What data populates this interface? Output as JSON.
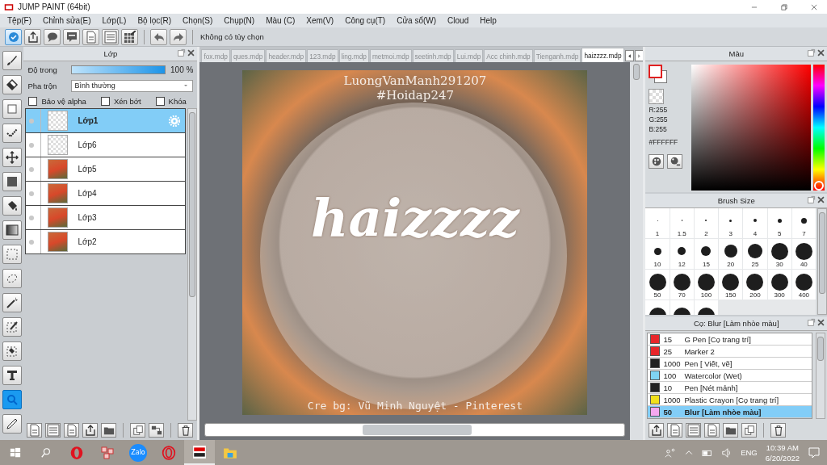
{
  "window": {
    "title": "JUMP PAINT (64bit)"
  },
  "menu": [
    "Tệp(F)",
    "Chỉnh sửa(E)",
    "Lớp(L)",
    "Bộ lọc(R)",
    "Chọn(S)",
    "Chụp(N)",
    "Màu (C)",
    "Xem(V)",
    "Công cụ(T)",
    "Cửa sổ(W)",
    "Cloud",
    "Help"
  ],
  "toolbar": {
    "buttons": [
      {
        "kind": "check",
        "selected": true
      },
      {
        "kind": "share",
        "selected": false
      },
      {
        "kind": "bubble",
        "selected": false
      },
      {
        "kind": "comment",
        "selected": false
      },
      {
        "kind": "page",
        "selected": false
      },
      {
        "kind": "list",
        "selected": false
      },
      {
        "kind": "grid",
        "selected": false
      }
    ],
    "history": [
      {
        "kind": "undo"
      },
      {
        "kind": "redo"
      }
    ],
    "options_text": "Không có tùy chọn"
  },
  "tools": [
    {
      "kind": "brush",
      "selected": false
    },
    {
      "kind": "eraser",
      "selected": false
    },
    {
      "kind": "square",
      "selected": false
    },
    {
      "kind": "line",
      "selected": false
    },
    {
      "kind": "move",
      "selected": false
    },
    {
      "kind": "fill-rect",
      "selected": false
    },
    {
      "kind": "bucket",
      "selected": false
    },
    {
      "kind": "gradient",
      "selected": false
    },
    {
      "kind": "rect-select",
      "selected": false
    },
    {
      "kind": "lasso",
      "selected": false
    },
    {
      "kind": "wand",
      "selected": false
    },
    {
      "kind": "select-pen",
      "selected": false
    },
    {
      "kind": "select-eraser",
      "selected": false
    },
    {
      "kind": "text",
      "selected": false
    },
    {
      "kind": "zoom",
      "selected": true
    },
    {
      "kind": "pen",
      "selected": false
    }
  ],
  "layer_panel": {
    "title": "Lớp",
    "opacity": {
      "label": "Độ trong",
      "level": 1.0,
      "reading": "100 %"
    },
    "blend": {
      "label": "Pha trộn",
      "value": "Bình thường"
    },
    "options": [
      {
        "label": "Bảo vệ alpha",
        "checked": false
      },
      {
        "label": "Xén bớt",
        "checked": false
      },
      {
        "label": "Khóa",
        "checked": false
      }
    ],
    "layers": [
      {
        "name": "Lớp1",
        "kind": "transparent",
        "selected": true
      },
      {
        "name": "Lớp6",
        "kind": "transparent",
        "selected": false
      },
      {
        "name": "Lớp5",
        "kind": "photo",
        "selected": false
      },
      {
        "name": "Lớp4",
        "kind": "photo",
        "selected": false
      },
      {
        "name": "Lớp3",
        "kind": "photo",
        "selected": false
      },
      {
        "name": "Lớp2",
        "kind": "photo",
        "selected": false
      }
    ]
  },
  "document_tabs": [
    {
      "label": "fox.mdp",
      "selected": false
    },
    {
      "label": "ques.mdp",
      "selected": false
    },
    {
      "label": "header.mdp",
      "selected": false
    },
    {
      "label": "123.mdp",
      "selected": false
    },
    {
      "label": "ling.mdp",
      "selected": false
    },
    {
      "label": "metmoi.mdp",
      "selected": false
    },
    {
      "label": "seetinh.mdp",
      "selected": false
    },
    {
      "label": "Lui.mdp",
      "selected": false
    },
    {
      "label": "Acc chinh.mdp",
      "selected": false
    },
    {
      "label": "Tienganh.mdp",
      "selected": false
    },
    {
      "label": "haizzzz.mdp",
      "selected": true
    }
  ],
  "canvas": {
    "top_text": "LuongVanManh291207",
    "hashtag": "#Hoidap247",
    "title": "haizzzz",
    "credit": "Cre bg: Vũ Minh Nguyệt - Pinterest"
  },
  "color_panel": {
    "title": "Màu",
    "r": "R:255",
    "g": "G:255",
    "b": "B:255",
    "hex": "#FFFFFF"
  },
  "brush_size_panel": {
    "title": "Brush Size",
    "sizes": [
      {
        "kind": "labeled",
        "label": "1"
      },
      {
        "kind": "labeled",
        "label": "1.5"
      },
      {
        "kind": "labeled",
        "label": "2"
      },
      {
        "kind": "labeled",
        "label": "3"
      },
      {
        "kind": "labeled",
        "label": "4"
      },
      {
        "kind": "labeled",
        "label": "5"
      },
      {
        "kind": "labeled",
        "label": "7"
      },
      {
        "kind": "labeled",
        "label": "10"
      },
      {
        "kind": "labeled",
        "label": "12"
      },
      {
        "kind": "labeled",
        "label": "15"
      },
      {
        "kind": "labeled",
        "label": "20"
      },
      {
        "kind": "labeled",
        "label": "25"
      },
      {
        "kind": "labeled",
        "label": "30"
      },
      {
        "kind": "labeled",
        "label": "40"
      },
      {
        "kind": "labeled",
        "label": "50"
      },
      {
        "kind": "labeled",
        "label": "70"
      },
      {
        "kind": "labeled",
        "label": "100"
      },
      {
        "kind": "labeled",
        "label": "150"
      },
      {
        "kind": "labeled",
        "label": "200"
      },
      {
        "kind": "labeled",
        "label": "300"
      },
      {
        "kind": "labeled",
        "label": "400"
      },
      {
        "kind": "cut"
      },
      {
        "kind": "cut"
      },
      {
        "kind": "cut"
      }
    ]
  },
  "brush_panel": {
    "title": "Cọ: Blur [Làm nhòe màu]",
    "brushes": [
      {
        "size": "15",
        "name": "G Pen [Cọ trang trí]",
        "color": "#e8262a",
        "selected": false
      },
      {
        "size": "25",
        "name": "Marker 2",
        "color": "#e8262a",
        "selected": false
      },
      {
        "size": "1000",
        "name": "Pen [ Viết, vẽ]",
        "color": "#222222",
        "selected": false
      },
      {
        "size": "100",
        "name": "Watercolor (Wet)",
        "color": "#7fd3f2",
        "selected": false
      },
      {
        "size": "10",
        "name": "Pen [Nét mảnh]",
        "color": "#222222",
        "selected": false
      },
      {
        "size": "1000",
        "name": "Plastic Crayon [Cọ trang trí]",
        "color": "#f2e01a",
        "selected": false
      },
      {
        "size": "50",
        "name": "Blur [Làm nhòe màu]",
        "color": "#f5a8f0",
        "selected": true
      }
    ]
  },
  "taskbar": {
    "apps": [
      {
        "kind": "opera",
        "active": false
      },
      {
        "kind": "grid-app",
        "active": false
      },
      {
        "kind": "zalo",
        "label": "Zalo",
        "active": false
      },
      {
        "kind": "opera-gx",
        "active": false
      },
      {
        "kind": "paint",
        "active": true
      },
      {
        "kind": "folder",
        "active": false
      }
    ],
    "language": "ENG",
    "time": "10:39 AM",
    "date": "6/20/2022"
  }
}
